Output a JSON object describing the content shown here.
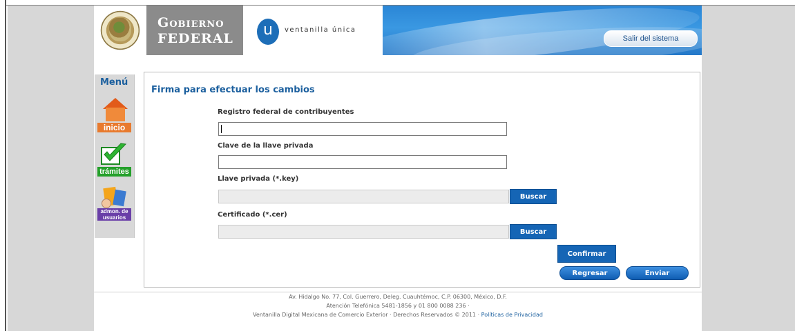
{
  "header": {
    "gobierno_line1": "Gobierno",
    "gobierno_line2": "FEDERAL",
    "vu_logo_letter": "u",
    "vu_text": "ventanilla única",
    "salir_label": "Salir del sistema"
  },
  "menu": {
    "title": "Menú",
    "items": [
      {
        "label": "inicio",
        "icon": "house-icon"
      },
      {
        "label": "trámites",
        "icon": "checkmark-icon"
      },
      {
        "label_line1": "admon. de",
        "label_line2": "usuarios",
        "icon": "users-admin-icon"
      }
    ]
  },
  "form": {
    "title": "Firma para efectuar los cambios",
    "rfc_label": "Registro federal de contribuyentes",
    "rfc_value": "",
    "clave_label": "Clave de la llave privada",
    "clave_value": "",
    "key_label": "Llave privada (*.key)",
    "cer_label": "Certificado (*.cer)",
    "buscar_label": "Buscar",
    "confirmar_label": "Confirmar",
    "regresar_label": "Regresar",
    "enviar_label": "Enviar"
  },
  "footer": {
    "line1": "Av. Hidalgo No. 77, Col. Guerrero, Deleg. Cuauhtémoc, C.P. 06300, México, D.F.",
    "line2": "Atención Telefónica 5481-1856 y 01 800 0088 236 ·",
    "line3": "Ventanilla Digital Mexicana de Comercio Exterior · Derechos Reservados © 2011 · ",
    "privacy_link": "Políticas de Privacidad"
  },
  "colors": {
    "accent_blue": "#1565b5",
    "title_blue": "#1b5f9e",
    "header_blue": "#2a86d6",
    "gobierno_gray": "#8b8b8b"
  }
}
